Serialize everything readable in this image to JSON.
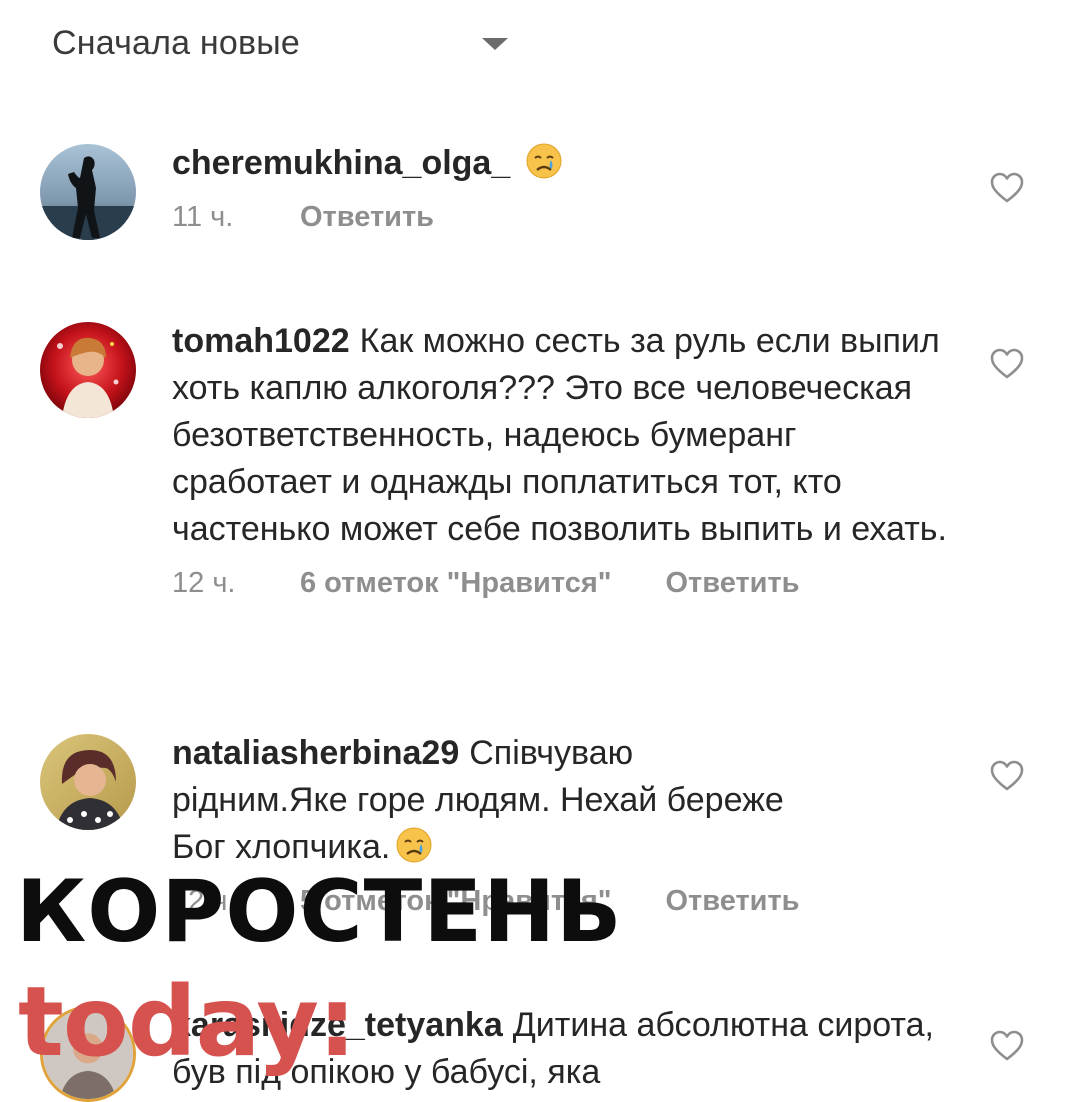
{
  "sort": {
    "label": "Сначала новые"
  },
  "comments": [
    {
      "username": "cheremukhina_olga_",
      "text": "",
      "time": "11 ч.",
      "likes": "",
      "reply": "Ответить",
      "emoji": "crying-face"
    },
    {
      "username": "tomah1022",
      "text": "Как можно сесть за руль если выпил хоть каплю алкоголя??? Это все человеческая безответственность, надеюсь бумеранг сработает и однажды поплатиться тот, кто частенько может себе позволить выпить и ехать.",
      "time": "12 ч.",
      "likes": "6 отметок \"Нравится\"",
      "reply": "Ответить"
    },
    {
      "username": "nataliasherbina29",
      "text": "Співчуваю рідним.Яке горе людям. Нехай береже Бог хлопчика.",
      "time": "12 ч.",
      "likes": "5 отметок \"Нравится\"",
      "reply": "Ответить",
      "emoji": "crying-face"
    },
    {
      "username": "karasilidze_tetyanka",
      "text": "Дитина абсолютна сирота, був під опікою у бабусі, яка",
      "time": "",
      "likes": "",
      "reply": ""
    }
  ],
  "watermark": {
    "line1": "КОРОСТЕНЬ",
    "line2": "today:",
    "colors": {
      "line1": "#0d0d0d",
      "line2": "#d6524f"
    }
  },
  "colors": {
    "text": "#262626",
    "meta": "#8e8e8e",
    "heart": "#8e8e8e"
  }
}
